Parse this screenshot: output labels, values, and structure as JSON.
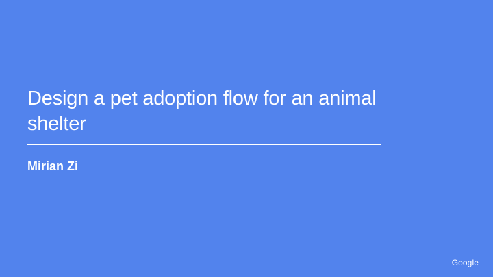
{
  "slide": {
    "background_color": "#5283ED",
    "text_color": "#FFFFFF",
    "title": "Design a pet adoption flow for an animal shelter",
    "subtitle": "Mirian Zi",
    "logo_text": "Google"
  }
}
